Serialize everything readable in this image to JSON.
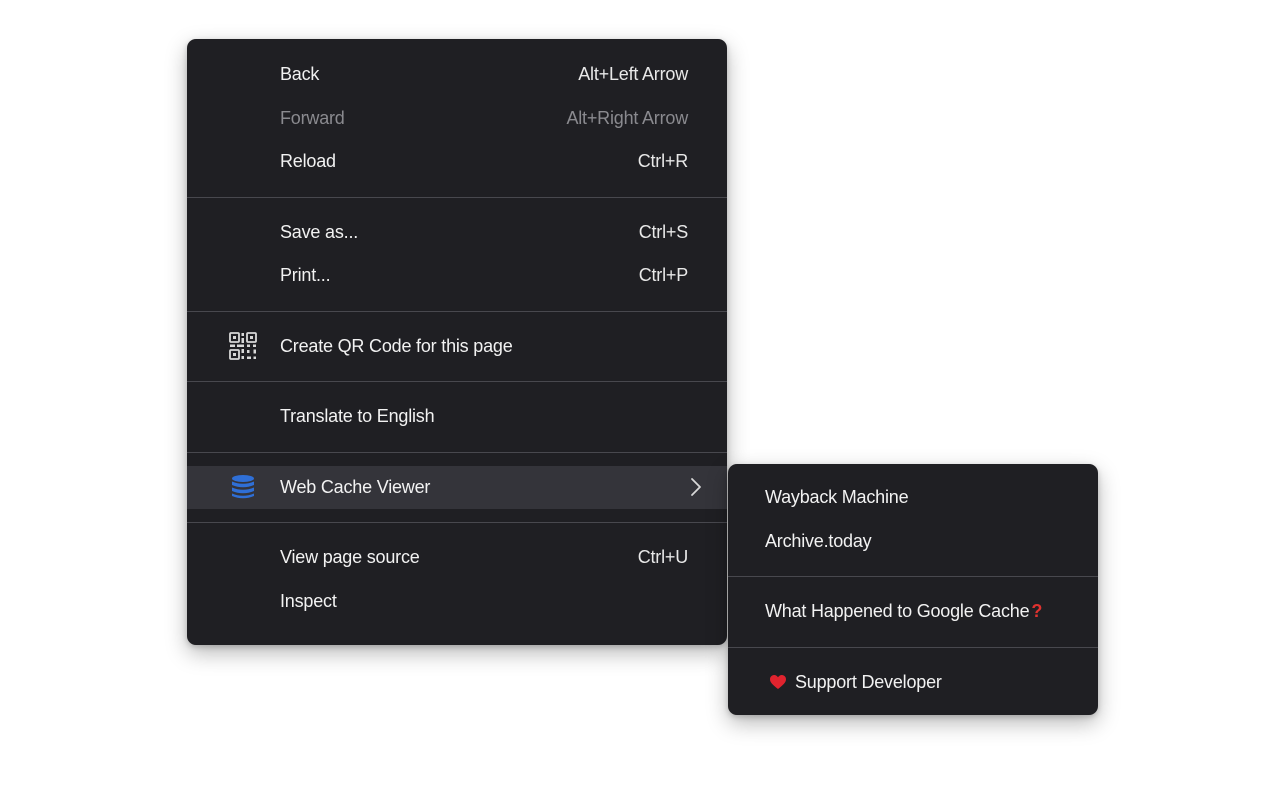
{
  "main_menu": {
    "back": {
      "label": "Back",
      "shortcut": "Alt+Left Arrow"
    },
    "forward": {
      "label": "Forward",
      "shortcut": "Alt+Right Arrow"
    },
    "reload": {
      "label": "Reload",
      "shortcut": "Ctrl+R"
    },
    "save_as": {
      "label": "Save as...",
      "shortcut": "Ctrl+S"
    },
    "print": {
      "label": "Print...",
      "shortcut": "Ctrl+P"
    },
    "qr_code": {
      "label": "Create QR Code for this page",
      "icon": "qr-code-icon"
    },
    "translate": {
      "label": "Translate to English"
    },
    "web_cache_viewer": {
      "label": "Web Cache Viewer",
      "icon": "database-icon",
      "icon_color": "#2f6fd6"
    },
    "view_source": {
      "label": "View page source",
      "shortcut": "Ctrl+U"
    },
    "inspect": {
      "label": "Inspect"
    }
  },
  "sub_menu": {
    "wayback": {
      "label": "Wayback Machine"
    },
    "archive_today": {
      "label": "Archive.today"
    },
    "what_happened": {
      "label": "What Happened to Google Cache",
      "suffix": "?"
    },
    "support": {
      "label": "Support Developer",
      "icon": "heart-icon",
      "icon_color": "#e0232e"
    }
  }
}
